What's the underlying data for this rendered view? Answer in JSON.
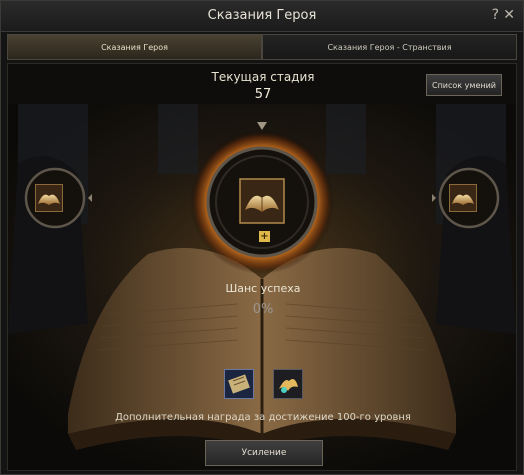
{
  "window": {
    "title": "Сказания Героя"
  },
  "tabs": [
    {
      "label": "Сказания Героя"
    },
    {
      "label": "Сказания Героя - Странствия"
    }
  ],
  "stage": {
    "label": "Текущая стадия",
    "value": "57"
  },
  "skill_list_button": "Список умений",
  "success": {
    "label": "Шанс успеха",
    "value": "0%"
  },
  "reward_text": "Дополнительная награда за достижение 100-го уровня",
  "upgrade_button": "Усиление",
  "icons": {
    "help": "help-icon",
    "close": "close-icon",
    "center": "book-icon",
    "left": "book-icon",
    "right": "book-icon",
    "reward1": "scroll-icon",
    "reward2": "gem-icon"
  }
}
